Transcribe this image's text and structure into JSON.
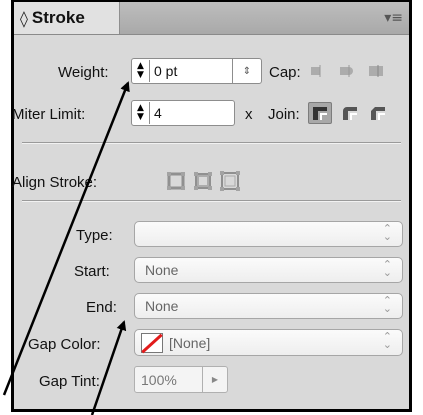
{
  "panel": {
    "title": "Stroke",
    "title_glyph": "◊",
    "menu_glyph": "▾≡"
  },
  "weight": {
    "label": "Weight:",
    "value": "0 pt",
    "unit_arrows": "⌃⌄"
  },
  "cap": {
    "label": "Cap:"
  },
  "miter": {
    "label": "Miter Limit:",
    "value": "4",
    "suffix": "x"
  },
  "join": {
    "label": "Join:"
  },
  "align": {
    "label": "Align Stroke:"
  },
  "type": {
    "label": "Type:",
    "value": ""
  },
  "start": {
    "label": "Start:",
    "value": "None"
  },
  "end": {
    "label": "End:",
    "value": "None"
  },
  "gap_color": {
    "label": "Gap Color:",
    "value": "[None]"
  },
  "gap_tint": {
    "label": "Gap Tint:",
    "value": "100%",
    "play_glyph": "▶"
  },
  "accent": {
    "red": "#e21b1b",
    "panel_bg": "#d9d9d9"
  }
}
